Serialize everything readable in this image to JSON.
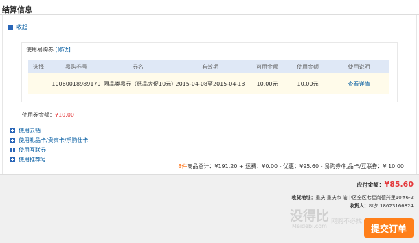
{
  "section_title": "结算信息",
  "collapse_label": "收起",
  "coupon": {
    "label": "使用易购券",
    "modify": "[修改]",
    "columns": [
      "选择",
      "易购券号",
      "券名",
      "有效期",
      "可用金额",
      "使用金额",
      "使用说明"
    ],
    "row": {
      "select": "",
      "number": "10060018989179",
      "name": "限品类易券（纸品大促10元）",
      "validity": "2015-04-08至2015-04-13",
      "available": "10.00元",
      "used": "10.00元",
      "details": "查看详情"
    },
    "amount_label": "使用券金额：",
    "amount_value": "¥10.00"
  },
  "options": [
    {
      "label": "使用云钻"
    },
    {
      "label": "使用礼品卡/贵宾卡/乐购仕卡"
    },
    {
      "label": "使用互联券"
    },
    {
      "label": "使用推荐号"
    }
  ],
  "summary": {
    "count": "8件",
    "text": "商品总计：¥191.20 + 运费：¥0.00 - 优惠：¥95.60 - 易购券/礼品卡/互联券：¥ 10.00"
  },
  "footer": {
    "due_label": "应付金额：",
    "due_value": "¥85.60",
    "address_label": "收货地址：",
    "address_value": "重庆 重庆市 渝中区全区七星岗德兴里10#6-2",
    "receiver_label": "收货人：",
    "receiver_value": "林夕 18623166824",
    "submit_label": "提交订单"
  },
  "watermark": {
    "main": "没得比",
    "sub": "Meidebi.com",
    "tag": "网购不必找"
  },
  "colors": {
    "accent_blue": "#005aa0",
    "price_red": "#e4393c",
    "submit_orange": "#ff7f1a",
    "table_header": "#dfe8f6",
    "table_row": "#fffbea"
  }
}
